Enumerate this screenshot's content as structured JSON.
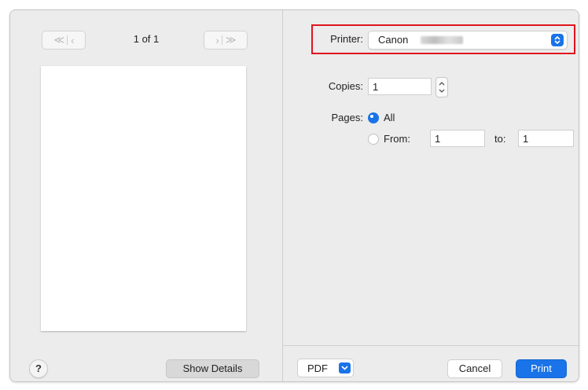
{
  "preview": {
    "first_prev_nav": "≪ | ‹",
    "next_last_nav": "› | ≫",
    "page_indicator": "1 of 1",
    "help_label": "?",
    "show_details_label": "Show Details"
  },
  "settings": {
    "printer_label": "Printer:",
    "printer_value": "Canon",
    "copies_label": "Copies:",
    "copies_value": "1",
    "pages_label": "Pages:",
    "pages_options": [
      {
        "label": "All",
        "selected": true
      },
      {
        "label": "From:",
        "selected": false
      }
    ],
    "from_value": "1",
    "to_label": "to:",
    "to_value": "1"
  },
  "footer": {
    "pdf_label": "PDF",
    "cancel_label": "Cancel",
    "print_label": "Print"
  },
  "colors": {
    "accent": "#1a73e8",
    "highlight": "#e0141e"
  }
}
